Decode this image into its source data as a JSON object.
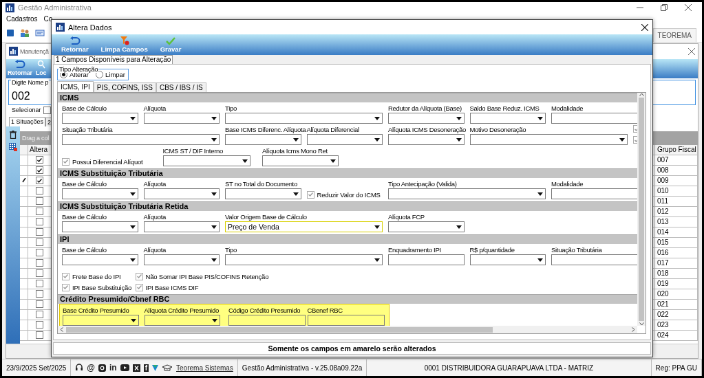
{
  "app": {
    "title": "Gestão Administrativa",
    "menu": [
      "Cadastros",
      "Co"
    ],
    "right_tab": "TEOREMA"
  },
  "child_window": {
    "title": "Manutençã",
    "toolbar": [
      "Retornar",
      "Loc"
    ],
    "search": {
      "label": "Digite Nome p",
      "value": "002"
    },
    "select_all": {
      "label": "Selecionar",
      "checked": false
    },
    "tabs": [
      {
        "label": "1 Situações",
        "selected": true
      },
      {
        "label": "2",
        "selected": false
      }
    ],
    "grid": {
      "group_hint": "Drag a col",
      "columns": [
        "Altera",
        "Grupo Fiscal"
      ],
      "rows": [
        {
          "altera": true,
          "editing": false,
          "grupo": "007"
        },
        {
          "altera": true,
          "editing": false,
          "grupo": "008"
        },
        {
          "altera": true,
          "editing": true,
          "grupo": "009"
        },
        {
          "altera": false,
          "editing": false,
          "grupo": "010"
        },
        {
          "altera": false,
          "editing": false,
          "grupo": "011"
        },
        {
          "altera": false,
          "editing": false,
          "grupo": "012"
        },
        {
          "altera": false,
          "editing": false,
          "grupo": "013"
        },
        {
          "altera": false,
          "editing": false,
          "grupo": "014"
        },
        {
          "altera": false,
          "editing": false,
          "grupo": "015"
        },
        {
          "altera": false,
          "editing": false,
          "grupo": "016"
        },
        {
          "altera": false,
          "editing": false,
          "grupo": "017"
        },
        {
          "altera": false,
          "editing": false,
          "grupo": "018"
        },
        {
          "altera": false,
          "editing": false,
          "grupo": "019"
        },
        {
          "altera": false,
          "editing": false,
          "grupo": "020"
        },
        {
          "altera": false,
          "editing": false,
          "grupo": "021"
        },
        {
          "altera": false,
          "editing": false,
          "grupo": "022"
        },
        {
          "altera": false,
          "editing": false,
          "grupo": "023"
        },
        {
          "altera": false,
          "editing": false,
          "grupo": "024"
        }
      ]
    }
  },
  "dialog": {
    "title": "Altera Dados",
    "toolbar": [
      {
        "label": "Retornar",
        "kind": "back"
      },
      {
        "label": "Limpa Campos",
        "kind": "clear"
      },
      {
        "label": "Gravar",
        "kind": "save"
      }
    ],
    "page_tab": "1 Campos Disponíveis para Alteração",
    "mode": {
      "title": "Tipo Alteração",
      "options": [
        {
          "label": "Alterar",
          "selected": true
        },
        {
          "label": "Limpar",
          "selected": false
        }
      ]
    },
    "tabs": [
      {
        "label": "ICMS, IPI",
        "selected": true
      },
      {
        "label": "PIS, COFINS, ISS",
        "selected": false
      },
      {
        "label": "CBS / IBS / IS",
        "selected": false
      }
    ],
    "sections": [
      {
        "title": "ICMS",
        "highlighted": false,
        "side_checks": [
          {
            "checked": true
          },
          {
            "checked": true
          }
        ],
        "fields": [
          {
            "kind": "combo",
            "label": "Base de Cálculo"
          },
          {
            "kind": "combo",
            "label": "Alíquota"
          },
          {
            "kind": "combo",
            "label": "Tipo"
          },
          {
            "kind": "combo",
            "label": "Redutor da Alíquota (Base)"
          },
          {
            "kind": "combo",
            "label": "Saldo Base Reduz. ICMS"
          },
          {
            "kind": "text",
            "label": "Modalidade"
          },
          {
            "kind": "combo",
            "label": "Situação Tributária"
          },
          {
            "kind": "combo",
            "label": "Base ICMS Diferenc. Alíquota"
          },
          {
            "kind": "combo",
            "label": "Alíquota Diferencial"
          },
          {
            "kind": "combo",
            "label": "Alíquota ICMS Desoneração"
          },
          {
            "kind": "combo",
            "label": "Motivo Desoneração"
          },
          {
            "kind": "check",
            "label": "Possui Diferencial Alíquot",
            "checked": true
          },
          {
            "kind": "combo",
            "label": "ICMS ST / DIF Interno"
          },
          {
            "kind": "combo",
            "label": "Alíquota Icms Mono Ret"
          }
        ]
      },
      {
        "title": "ICMS Substituição Tributária",
        "highlighted": false,
        "fields": [
          {
            "kind": "combo",
            "label": "Base de Cálculo"
          },
          {
            "kind": "combo",
            "label": "Alíquota"
          },
          {
            "kind": "combo",
            "label": "ST no Total do Documento"
          },
          {
            "kind": "check",
            "label": "Reduzir Valor do ICMS",
            "checked": true
          },
          {
            "kind": "combo",
            "label": "Tipo Antecipação (Valida)"
          },
          {
            "kind": "text",
            "label": "Modalidade"
          }
        ]
      },
      {
        "title": "ICMS Substituição Tributária Retida",
        "highlighted": false,
        "fields": [
          {
            "kind": "combo",
            "label": "Base de Cálculo"
          },
          {
            "kind": "combo",
            "label": "Alíquota"
          },
          {
            "kind": "combo",
            "label": "Valor Origem Base de Cálculo",
            "value": "Preço de Venda",
            "focused": true
          },
          {
            "kind": "combo",
            "label": "Alíquota FCP"
          }
        ]
      },
      {
        "title": "IPI",
        "highlighted": false,
        "fields": [
          {
            "kind": "combo",
            "label": "Base de Cálculo"
          },
          {
            "kind": "combo",
            "label": "Alíquota"
          },
          {
            "kind": "combo",
            "label": "Tipo"
          },
          {
            "kind": "text",
            "label": "Enquadramento IPI"
          },
          {
            "kind": "combo",
            "label": "R$ p/quantidade"
          },
          {
            "kind": "text",
            "label": "Situação Tributária"
          },
          {
            "kind": "check",
            "label": "Frete Base do IPI",
            "checked": true
          },
          {
            "kind": "check",
            "label": "Não Somar IPI Base PIS/COFINS Retenção",
            "checked": true
          },
          {
            "kind": "check",
            "label": "IPI Base Substituição",
            "checked": true
          },
          {
            "kind": "check",
            "label": "IPI Base ICMS DIF",
            "checked": true
          }
        ]
      },
      {
        "title": "Crédito Presumido/Cbnef RBC",
        "highlighted": true,
        "fields": [
          {
            "kind": "combo",
            "label": "Base Crédito Presumido"
          },
          {
            "kind": "combo",
            "label": "Alíquota Crédito Presumido"
          },
          {
            "kind": "text",
            "label": "Código Crédito Presumido"
          },
          {
            "kind": "text",
            "label": "CBenef RBC"
          }
        ]
      }
    ],
    "footer": "Somente os campos em amarelo serão alterados"
  },
  "status_bar": {
    "date": "23/9/2025 Set/2025",
    "icon_texts": [
      "@",
      "in",
      "f"
    ],
    "link": "Teorema Sistemas",
    "version": "Gestão Administrativa - v.25.08a09.22a",
    "company": "0001 DISTRIBUIDORA GUARAPUAVA LTDA - MATRIZ",
    "reg": "Reg: PPA GU"
  }
}
